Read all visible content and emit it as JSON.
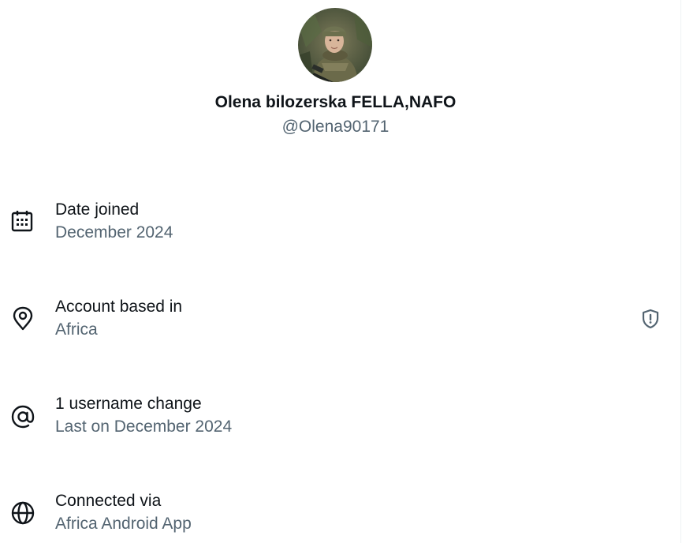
{
  "profile": {
    "name": "Olena bilozerska FELLA,NAFO",
    "handle": "@Olena90171"
  },
  "rows": [
    {
      "icon": "calendar-icon",
      "title": "Date joined",
      "subtitle": "December 2024"
    },
    {
      "icon": "location-pin-icon",
      "title": "Account based in",
      "subtitle": "Africa",
      "trailing_icon": "shield-alert-icon"
    },
    {
      "icon": "at-sign-icon",
      "title": "1 username change",
      "subtitle": "Last on December 2024"
    },
    {
      "icon": "globe-icon",
      "title": "Connected via",
      "subtitle": "Africa Android App"
    }
  ],
  "colors": {
    "primary_text": "#0f1419",
    "secondary_text": "#536471",
    "border": "#eff3f4"
  }
}
